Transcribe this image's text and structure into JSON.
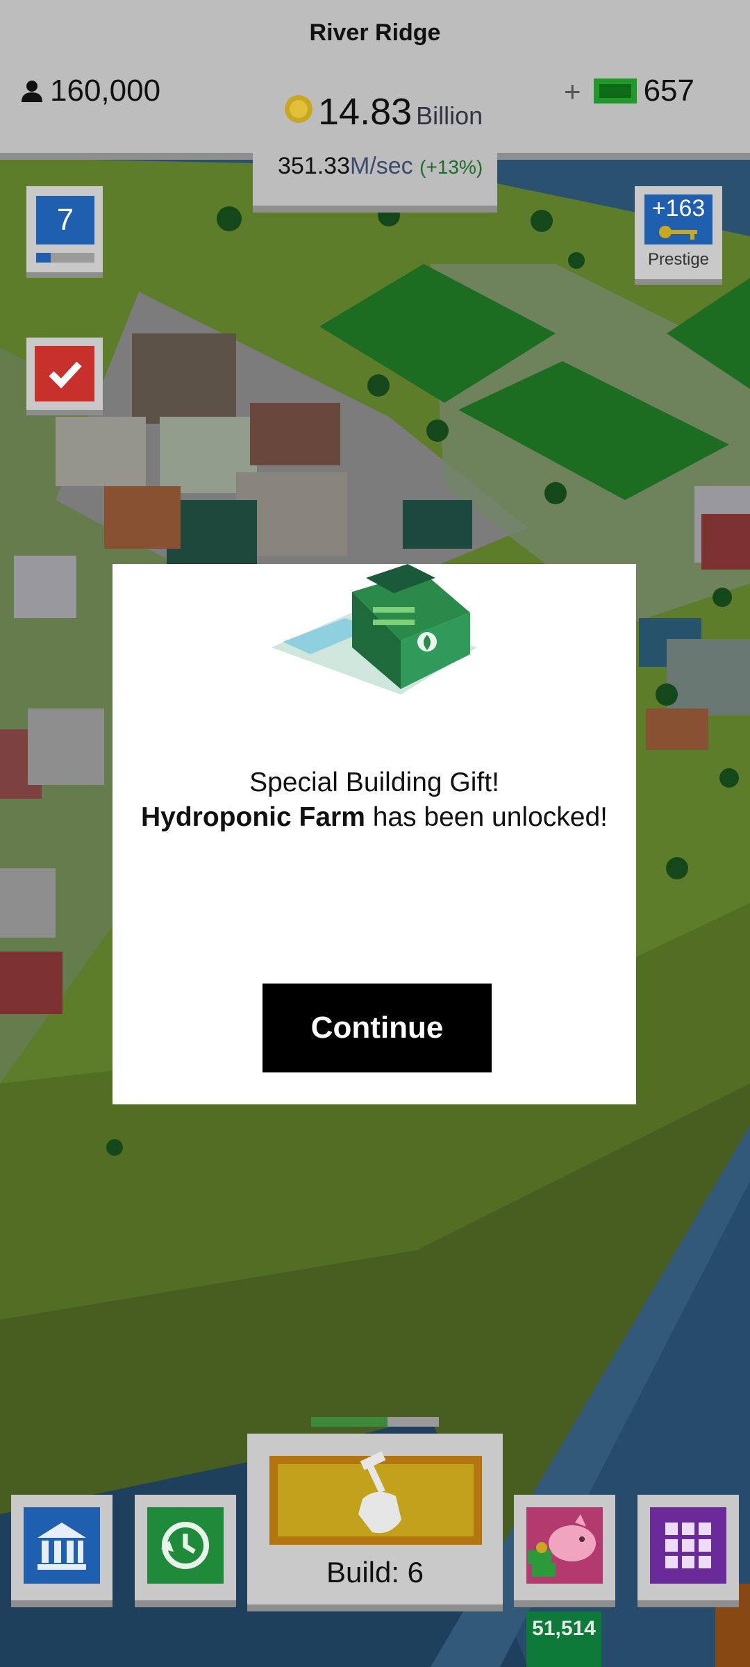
{
  "header": {
    "city_name": "River Ridge",
    "population": "160,000",
    "coins_amount": "14.83",
    "coins_unit": "Billion",
    "rate_value": "351.33",
    "rate_unit": "M/sec",
    "rate_bonus": "(+13%)",
    "cash_amount": "657",
    "add_cash_label": "+"
  },
  "side": {
    "level": "7",
    "level_progress": 0.25,
    "prestige_value": "+163",
    "prestige_label": "Prestige"
  },
  "dialog": {
    "line1": "Special Building Gift!",
    "building_name": "Hydroponic Farm",
    "line2_suffix": " has been unlocked!",
    "continue_label": "Continue"
  },
  "bottom": {
    "build_label": "Build: 6",
    "build_progress": 0.6,
    "piggy_bank_count": "51,514"
  },
  "colors": {
    "level_blue": "#1f5fb0",
    "todo_red": "#c8302c",
    "bank_blue": "#1f5fb0",
    "time_green": "#1f8a3a",
    "piggy_pink": "#b23a6f",
    "grid_purple": "#6a2a9a",
    "build_yellow": "#c2a21a"
  }
}
